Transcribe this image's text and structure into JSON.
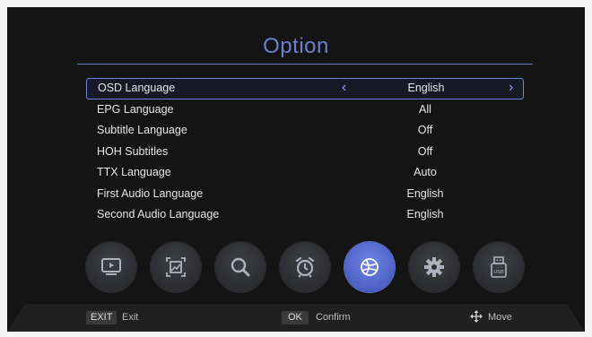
{
  "header": {
    "title": "Option"
  },
  "menu": {
    "rows": [
      {
        "label": "OSD Language",
        "value": "English"
      },
      {
        "label": "EPG Language",
        "value": "All"
      },
      {
        "label": "Subtitle Language",
        "value": "Off"
      },
      {
        "label": "HOH Subtitles",
        "value": "Off"
      },
      {
        "label": "TTX Language",
        "value": "Auto"
      },
      {
        "label": "First Audio Language",
        "value": "English"
      },
      {
        "label": "Second Audio Language",
        "value": "English"
      }
    ],
    "selected_index": 0,
    "arrow_left": "‹",
    "arrow_right": "›"
  },
  "toolbar": {
    "icons": [
      "tv-icon",
      "picture-icon",
      "search-icon",
      "alarm-clock-icon",
      "globe-icon",
      "gear-icon",
      "usb-icon"
    ],
    "active_icon": "globe-icon"
  },
  "footer": {
    "exit_key": "EXIT",
    "exit_label": "Exit",
    "ok_key": "OK",
    "ok_label": "Confirm",
    "move_label": "Move"
  },
  "colors": {
    "accent": "#6e7fcf",
    "active_icon_bg": "#5569cf",
    "background": "#141414"
  }
}
